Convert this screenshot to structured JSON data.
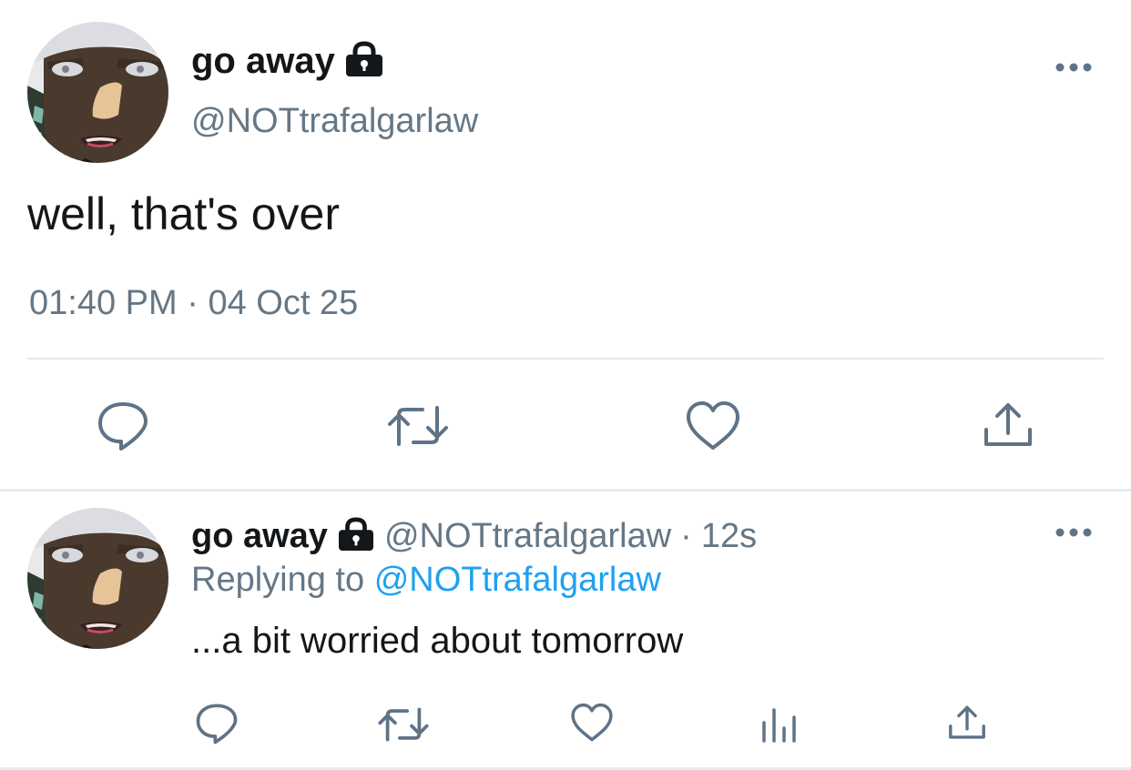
{
  "main_tweet": {
    "display_name": "go away",
    "handle": "@NOTtrafalgarlaw",
    "text": "well, that's over",
    "time": "01:40 PM",
    "separator": "·",
    "date": "04 Oct 25",
    "avatar_icon": "anime-character-avatar",
    "lock_icon": "lock-icon",
    "more_icon": "more-options-icon"
  },
  "main_actions": [
    {
      "name": "reply",
      "icon": "reply-icon"
    },
    {
      "name": "retweet",
      "icon": "retweet-icon"
    },
    {
      "name": "like",
      "icon": "heart-icon"
    },
    {
      "name": "share",
      "icon": "share-icon"
    }
  ],
  "reply_tweet": {
    "display_name": "go away",
    "handle": "@NOTtrafalgarlaw",
    "separator": "·",
    "age": "12s",
    "replying_prefix": "Replying to",
    "replying_to": "@NOTtrafalgarlaw",
    "text": "...a bit worried about tomorrow"
  },
  "reply_actions": [
    {
      "name": "reply",
      "icon": "reply-icon"
    },
    {
      "name": "retweet",
      "icon": "retweet-icon"
    },
    {
      "name": "like",
      "icon": "heart-icon"
    },
    {
      "name": "analytics",
      "icon": "analytics-icon"
    },
    {
      "name": "share",
      "icon": "share-icon"
    }
  ],
  "colors": {
    "text_primary": "#14171a",
    "text_secondary": "#657786",
    "link": "#1da1f2",
    "icon": "#5f7386",
    "divider": "#e1e8ed"
  }
}
